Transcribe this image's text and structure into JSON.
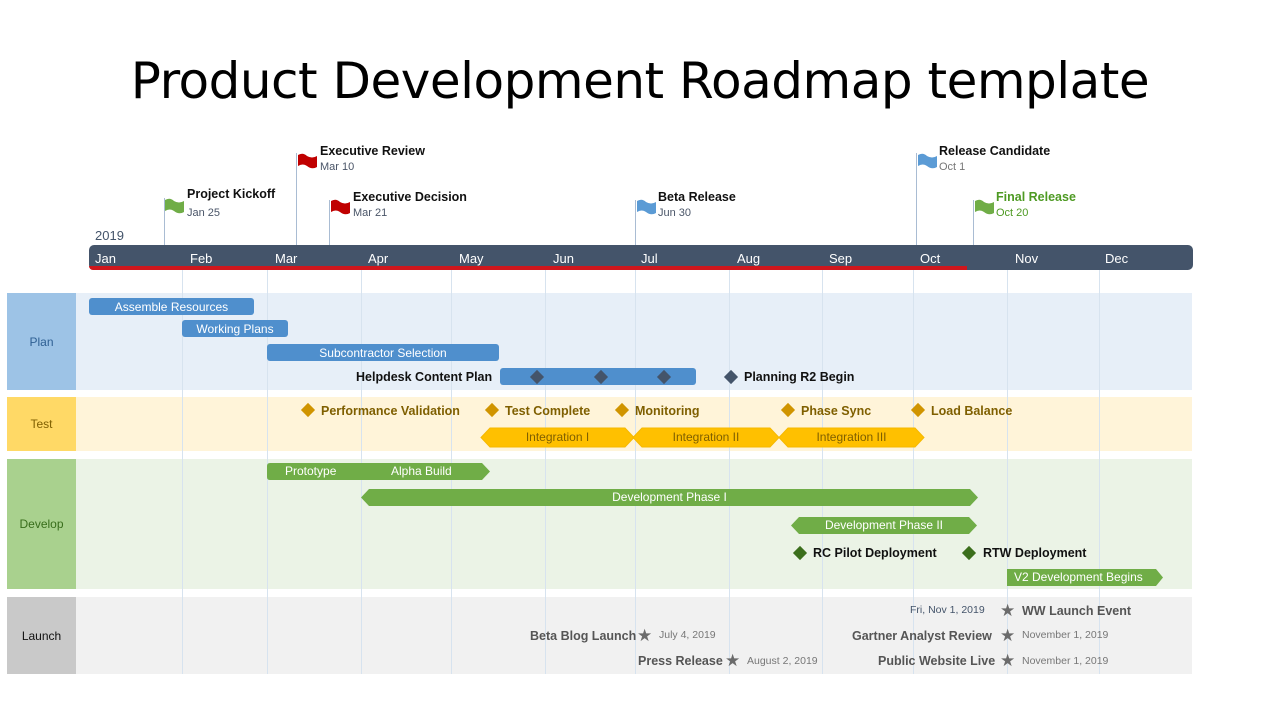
{
  "title": "Product Development Roadmap template",
  "timeline": {
    "year": "2019",
    "months": [
      "Jan",
      "Feb",
      "Mar",
      "Apr",
      "May",
      "Jun",
      "Jul",
      "Aug",
      "Sep",
      "Oct",
      "Nov",
      "Dec"
    ],
    "today_progress_through": "Oct 20"
  },
  "colors": {
    "timebar": "#44546a",
    "today": "#d0161c",
    "plan": "#4f8fcd",
    "test": "#ffc000",
    "develop": "#70ad47",
    "launch": "#6b6b6b",
    "flag_green": "#70ad47",
    "flag_red": "#c00000",
    "flag_blue": "#5b9bd5"
  },
  "milestones": [
    {
      "title": "Project Kickoff",
      "date": "Jan 25",
      "flag": "green-flag-icon"
    },
    {
      "title": "Executive Review",
      "date": "Mar 10",
      "flag": "red-flag-icon"
    },
    {
      "title": "Executive Decision",
      "date": "Mar 21",
      "flag": "red-flag-icon"
    },
    {
      "title": "Beta Release",
      "date": "Jun 30",
      "flag": "blue-flag-icon"
    },
    {
      "title": "Release Candidate",
      "date": "Oct 1",
      "flag": "blue-flag-icon"
    },
    {
      "title": "Final Release",
      "date": "Oct 20",
      "flag": "green-flag-icon"
    }
  ],
  "lanes": {
    "plan": {
      "label": "Plan",
      "tasks": [
        "Assemble Resources",
        "Working Plans",
        "Subcontractor Selection"
      ],
      "helpdesk": "Helpdesk Content Plan",
      "planning_r2": "Planning R2 Begin"
    },
    "test": {
      "label": "Test",
      "milestones": [
        "Performance Validation",
        "Test Complete",
        "Monitoring",
        "Phase Sync",
        "Load Balance"
      ],
      "integrations": [
        "Integration I",
        "Integration II",
        "Integration III"
      ]
    },
    "develop": {
      "label": "Develop",
      "prototype": "Prototype",
      "alpha": "Alpha Build",
      "phase1": "Development Phase I",
      "phase2": "Development Phase II",
      "rc_pilot": "RC Pilot Deployment",
      "rtw": "RTW Deployment",
      "v2": "V2 Development Begins"
    },
    "launch": {
      "label": "Launch",
      "events": [
        {
          "title": "Beta Blog Launch",
          "date": "July 4, 2019"
        },
        {
          "title": "Press Release",
          "date": "August 2, 2019"
        },
        {
          "title": "WW Launch Event",
          "date": "Fri, Nov 1, 2019"
        },
        {
          "title": "Gartner Analyst Review",
          "date": "November 1, 2019"
        },
        {
          "title": "Public Website Live",
          "date": "November 1, 2019"
        }
      ]
    }
  }
}
